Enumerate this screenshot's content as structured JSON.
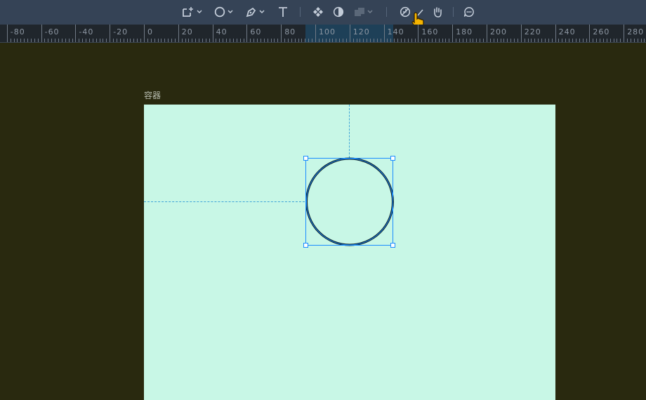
{
  "toolbar": {
    "tools": [
      {
        "name": "frame-tool",
        "icon": "frame-plus-icon",
        "dropdown": true
      },
      {
        "name": "ellipse-tool",
        "icon": "circle-icon",
        "dropdown": true
      },
      {
        "name": "pen-tool",
        "icon": "pen-icon",
        "dropdown": true
      },
      {
        "name": "text-tool",
        "icon": "text-T-icon",
        "dropdown": false
      },
      {
        "name": "component-tool",
        "icon": "component-diamond-icon",
        "dropdown": false
      },
      {
        "name": "mask-tool",
        "icon": "half-circle-icon",
        "dropdown": false
      },
      {
        "name": "boolean-tool",
        "icon": "boolean-squares-icon",
        "dropdown": true,
        "disabled": true
      },
      {
        "name": "slice-tool",
        "icon": "slice-circle-icon",
        "dropdown": false
      },
      {
        "name": "edit-tool",
        "icon": "pencil-icon",
        "dropdown": false
      },
      {
        "name": "hand-tool",
        "icon": "hand-icon",
        "dropdown": false
      },
      {
        "name": "comment-tool",
        "icon": "comment-icon",
        "dropdown": false
      }
    ]
  },
  "ruler": {
    "labels": [
      "-80",
      "-60",
      "-40",
      "-20",
      "0",
      "20",
      "40",
      "60",
      "80",
      "100",
      "120",
      "140",
      "160",
      "180",
      "200",
      "220",
      "240",
      "260",
      "280"
    ],
    "selection_range": [
      94,
      145
    ]
  },
  "canvas": {
    "frame_label": "容器"
  },
  "colors": {
    "accent": "#1a8cff",
    "artboard": "#c8f7e6",
    "canvas": "#29290f",
    "toolbar": "#354356"
  }
}
